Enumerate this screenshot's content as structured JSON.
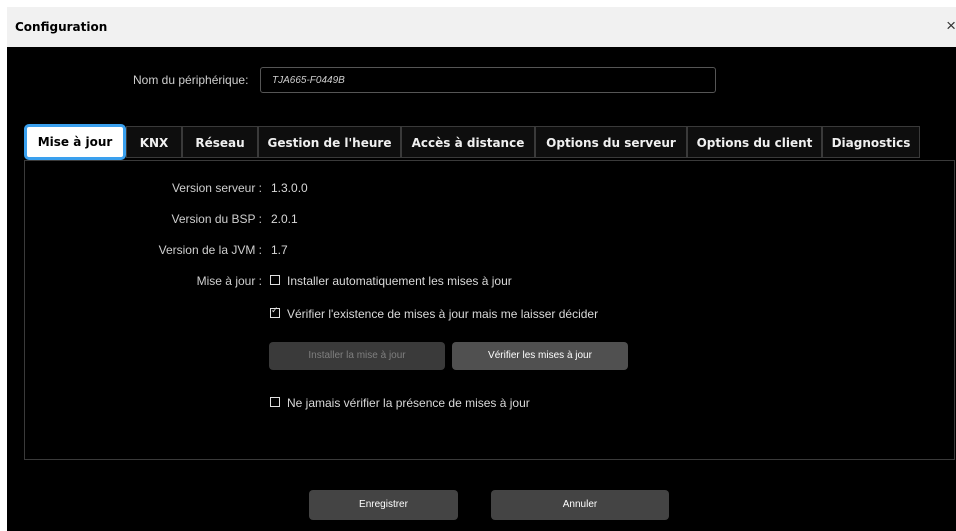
{
  "window": {
    "title": "Configuration",
    "close_icon": "×"
  },
  "device": {
    "label": "Nom du périphérique:",
    "value": "TJA665-F0449B"
  },
  "tabs": [
    {
      "label": "Mise à jour",
      "active": true
    },
    {
      "label": "KNX"
    },
    {
      "label": "Réseau"
    },
    {
      "label": "Gestion de l'heure"
    },
    {
      "label": "Accès à distance"
    },
    {
      "label": "Options du serveur"
    },
    {
      "label": "Options du client"
    },
    {
      "label": "Diagnostics"
    }
  ],
  "info": {
    "server_version_label": "Version serveur :",
    "server_version": "1.3.0.0",
    "bsp_version_label": "Version du BSP :",
    "bsp_version": "2.0.1",
    "jvm_version_label": "Version de la JVM :",
    "jvm_version": "1.7"
  },
  "update": {
    "label": "Mise à jour :",
    "options": [
      {
        "label": "Installer automatiquement les mises à jour",
        "checked": false
      },
      {
        "label": "Vérifier l'existence de mises à jour mais me laisser décider",
        "checked": true
      },
      {
        "label": "Ne jamais vérifier la présence de mises à jour",
        "checked": false
      }
    ],
    "install_button": "Installer la mise à jour",
    "check_button": "Vérifier les mises à jour"
  },
  "footer": {
    "save": "Enregistrer",
    "cancel": "Annuler"
  },
  "colors": {
    "accent": "#3aa0ee",
    "background": "#000000",
    "titlebar": "#f1f1f1"
  }
}
